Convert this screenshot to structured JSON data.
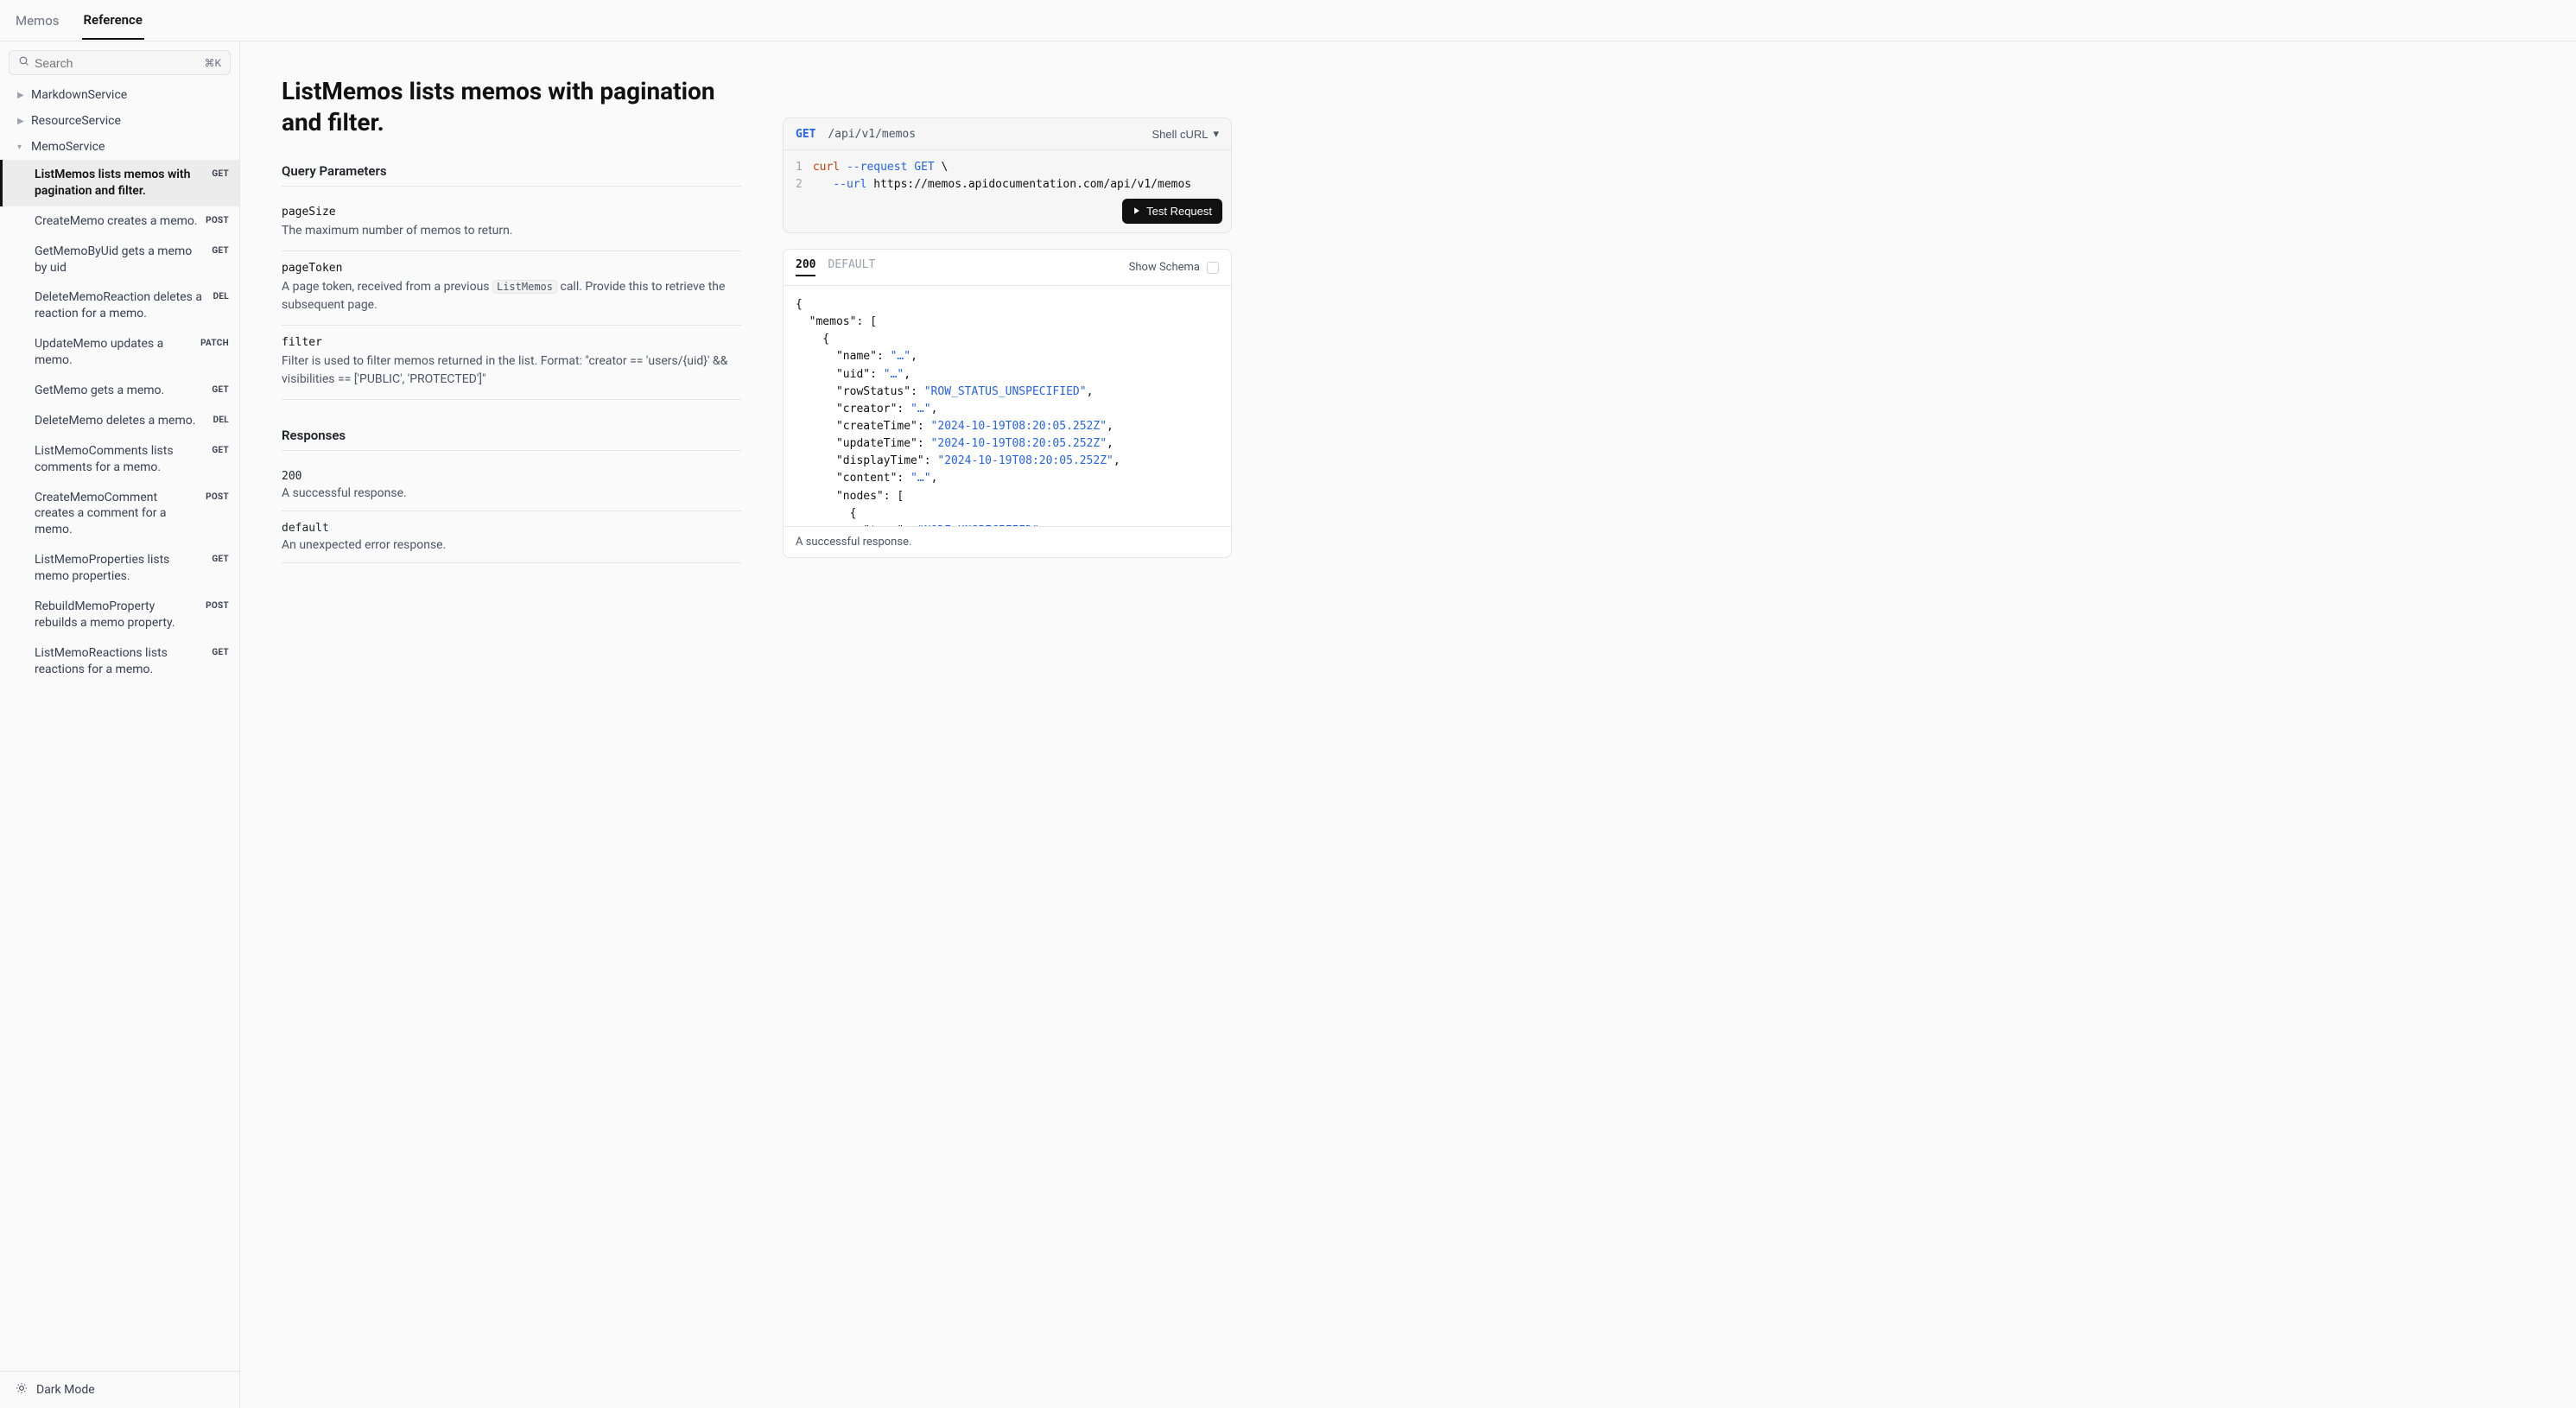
{
  "header": {
    "tabs": [
      "Memos",
      "Reference"
    ],
    "active_tab": "Reference"
  },
  "sidebar": {
    "search_placeholder": "Search",
    "search_shortcut": "⌘K",
    "groups": [
      {
        "name": "MarkdownService",
        "expanded": false
      },
      {
        "name": "ResourceService",
        "expanded": false
      },
      {
        "name": "MemoService",
        "expanded": true
      }
    ],
    "items": [
      {
        "label": "ListMemos lists memos with pagination and filter.",
        "method": "GET",
        "active": true
      },
      {
        "label": "CreateMemo creates a memo.",
        "method": "POST"
      },
      {
        "label": "GetMemoByUid gets a memo by uid",
        "method": "GET"
      },
      {
        "label": "DeleteMemoReaction deletes a reaction for a memo.",
        "method": "DEL"
      },
      {
        "label": "UpdateMemo updates a memo.",
        "method": "PATCH"
      },
      {
        "label": "GetMemo gets a memo.",
        "method": "GET"
      },
      {
        "label": "DeleteMemo deletes a memo.",
        "method": "DEL"
      },
      {
        "label": "ListMemoComments lists comments for a memo.",
        "method": "GET"
      },
      {
        "label": "CreateMemoComment creates a comment for a memo.",
        "method": "POST"
      },
      {
        "label": "ListMemoProperties lists memo properties.",
        "method": "GET"
      },
      {
        "label": "RebuildMemoProperty rebuilds a memo property.",
        "method": "POST"
      },
      {
        "label": "ListMemoReactions lists reactions for a memo.",
        "method": "GET"
      }
    ],
    "footer": "Dark Mode"
  },
  "page": {
    "title": "ListMemos lists memos with pagination and filter.",
    "query_params_heading": "Query Parameters",
    "params": [
      {
        "name": "pageSize",
        "desc": "The maximum number of memos to return."
      },
      {
        "name": "pageToken",
        "desc_pre": "A page token, received from a previous ",
        "desc_code": "ListMemos",
        "desc_post": " call. Provide this to retrieve the subsequent page."
      },
      {
        "name": "filter",
        "desc": "Filter is used to filter memos returned in the list. Format: \"creator == 'users/{uid}' && visibilities == ['PUBLIC', 'PROTECTED']\""
      }
    ],
    "responses_heading": "Responses",
    "responses": [
      {
        "code": "200",
        "desc": "A successful response."
      },
      {
        "code": "default",
        "desc": "An unexpected error response."
      }
    ]
  },
  "request": {
    "method": "GET",
    "path": "/api/v1/memos",
    "lang_label": "Shell cURL",
    "code": {
      "l1_cmd": "curl",
      "l1_flag": "--request",
      "l1_method": "GET",
      "l1_tail": " \\",
      "l2_flag": "--url",
      "l2_url": "https://memos.apidocumentation.com/api/v1/memos"
    },
    "test_label": "Test Request"
  },
  "response_panel": {
    "tabs": [
      "200",
      "DEFAULT"
    ],
    "active_tab": "200",
    "schema_label": "Show Schema",
    "footer": "A successful response.",
    "json": "{\n  \"memos\": [\n    {\n      \"name\": \"…\",\n      \"uid\": \"…\",\n      \"rowStatus\": \"ROW_STATUS_UNSPECIFIED\",\n      \"creator\": \"…\",\n      \"createTime\": \"2024-10-19T08:20:05.252Z\",\n      \"updateTime\": \"2024-10-19T08:20:05.252Z\",\n      \"displayTime\": \"2024-10-19T08:20:05.252Z\",\n      \"content\": \"…\",\n      \"nodes\": [\n        {\n          \"type\": \"NODE_UNSPECIFIED\","
  }
}
